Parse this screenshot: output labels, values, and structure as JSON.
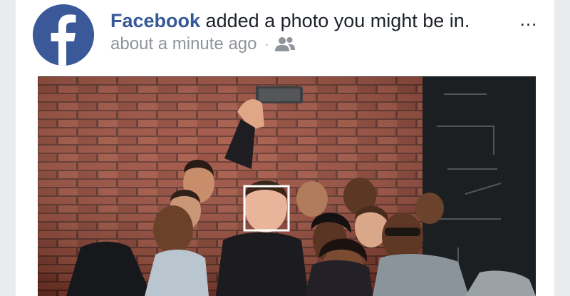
{
  "post": {
    "author": "Facebook",
    "action_text": " added a photo you might be in.",
    "timestamp": "about a minute ago",
    "separator": "·",
    "more_label": "...",
    "audience_icon": "friends-icon",
    "avatar_icon": "facebook-logo-icon"
  },
  "colors": {
    "brand": "#3b5998",
    "link": "#365899",
    "meta": "#90949c",
    "face_tag_box": "#ffffff"
  }
}
